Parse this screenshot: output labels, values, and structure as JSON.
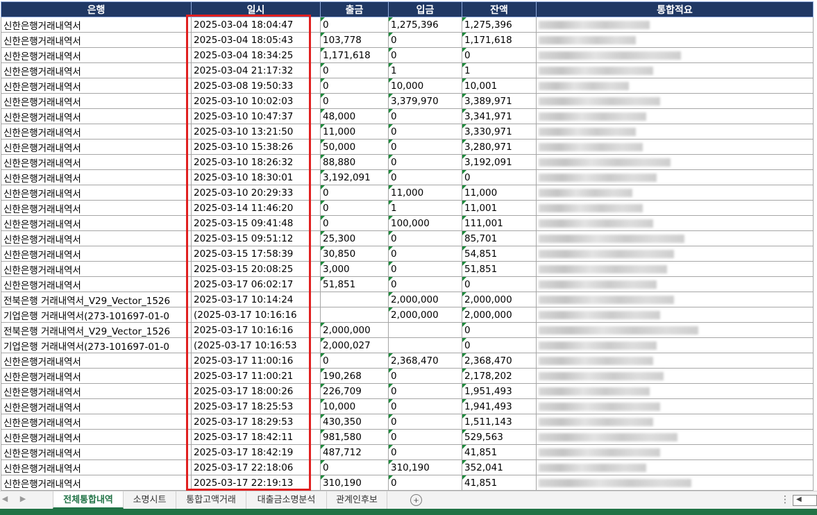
{
  "headers": [
    "은행",
    "일시",
    "출금",
    "입금",
    "잔액",
    "통합적요"
  ],
  "rows": [
    [
      "신한은행거래내역서",
      "2025-03-04 18:04:47",
      "0",
      "1,275,396",
      "1,275,396"
    ],
    [
      "신한은행거래내역서",
      "2025-03-04 18:05:43",
      "103,778",
      "0",
      "1,171,618"
    ],
    [
      "신한은행거래내역서",
      "2025-03-04 18:34:25",
      "1,171,618",
      "0",
      "0"
    ],
    [
      "신한은행거래내역서",
      "2025-03-04 21:17:32",
      "0",
      "1",
      "1"
    ],
    [
      "신한은행거래내역서",
      "2025-03-08 19:50:33",
      "0",
      "10,000",
      "10,001"
    ],
    [
      "신한은행거래내역서",
      "2025-03-10 10:02:03",
      "0",
      "3,379,970",
      "3,389,971"
    ],
    [
      "신한은행거래내역서",
      "2025-03-10 10:47:37",
      "48,000",
      "0",
      "3,341,971"
    ],
    [
      "신한은행거래내역서",
      "2025-03-10 13:21:50",
      "11,000",
      "0",
      "3,330,971"
    ],
    [
      "신한은행거래내역서",
      "2025-03-10 15:38:26",
      "50,000",
      "0",
      "3,280,971"
    ],
    [
      "신한은행거래내역서",
      "2025-03-10 18:26:32",
      "88,880",
      "0",
      "3,192,091"
    ],
    [
      "신한은행거래내역서",
      "2025-03-10 18:30:01",
      "3,192,091",
      "0",
      "0"
    ],
    [
      "신한은행거래내역서",
      "2025-03-10 20:29:33",
      "0",
      "11,000",
      "11,000"
    ],
    [
      "신한은행거래내역서",
      "2025-03-14 11:46:20",
      "0",
      "1",
      "11,001"
    ],
    [
      "신한은행거래내역서",
      "2025-03-15 09:41:48",
      "0",
      "100,000",
      "111,001"
    ],
    [
      "신한은행거래내역서",
      "2025-03-15 09:51:12",
      "25,300",
      "0",
      "85,701"
    ],
    [
      "신한은행거래내역서",
      "2025-03-15 17:58:39",
      "30,850",
      "0",
      "54,851"
    ],
    [
      "신한은행거래내역서",
      "2025-03-15 20:08:25",
      "3,000",
      "0",
      "51,851"
    ],
    [
      "신한은행거래내역서",
      "2025-03-17 06:02:17",
      "51,851",
      "0",
      "0"
    ],
    [
      "전북은행 거래내역서_V29_Vector_1526",
      "2025-03-17 10:14:24",
      "",
      "2,000,000",
      "2,000,000"
    ],
    [
      "기업은행 거래내역서(273-101697-01-0",
      "(2025-03-17 10:16:16",
      "",
      "2,000,000",
      "2,000,000"
    ],
    [
      "전북은행 거래내역서_V29_Vector_1526",
      "2025-03-17 10:16:16",
      "2,000,000",
      "",
      "0"
    ],
    [
      "기업은행 거래내역서(273-101697-01-0",
      "(2025-03-17 10:16:53",
      "2,000,027",
      "",
      "0"
    ],
    [
      "신한은행거래내역서",
      "2025-03-17 11:00:16",
      "0",
      "2,368,470",
      "2,368,470"
    ],
    [
      "신한은행거래내역서",
      "2025-03-17 11:00:21",
      "190,268",
      "0",
      "2,178,202"
    ],
    [
      "신한은행거래내역서",
      "2025-03-17 18:00:26",
      "226,709",
      "0",
      "1,951,493"
    ],
    [
      "신한은행거래내역서",
      "2025-03-17 18:25:53",
      "10,000",
      "0",
      "1,941,493"
    ],
    [
      "신한은행거래내역서",
      "2025-03-17 18:29:53",
      "430,350",
      "0",
      "1,511,143"
    ],
    [
      "신한은행거래내역서",
      "2025-03-17 18:42:11",
      "981,580",
      "0",
      "529,563"
    ],
    [
      "신한은행거래내역서",
      "2025-03-17 18:42:19",
      "487,712",
      "0",
      "41,851"
    ],
    [
      "신한은행거래내역서",
      "2025-03-17 22:18:06",
      "0",
      "310,190",
      "352,041"
    ],
    [
      "신한은행거래내역서",
      "2025-03-17 22:19:13",
      "310,190",
      "0",
      "41,851"
    ]
  ],
  "sheet_tabs": [
    {
      "label": "전체통합내역",
      "active": true
    },
    {
      "label": "소명시트",
      "active": false
    },
    {
      "label": "통합고액거래",
      "active": false
    },
    {
      "label": "대출금소명분석",
      "active": false
    },
    {
      "label": "관계인후보",
      "active": false
    }
  ],
  "colors": {
    "header_bg": "#203864",
    "highlight_box": "#e02020",
    "excel_green": "#217346"
  },
  "icons": {
    "add_sheet": "plus-circle-icon",
    "prev": "chevron-left-icon",
    "next": "chevron-right-icon",
    "more": "more-dots-icon"
  }
}
